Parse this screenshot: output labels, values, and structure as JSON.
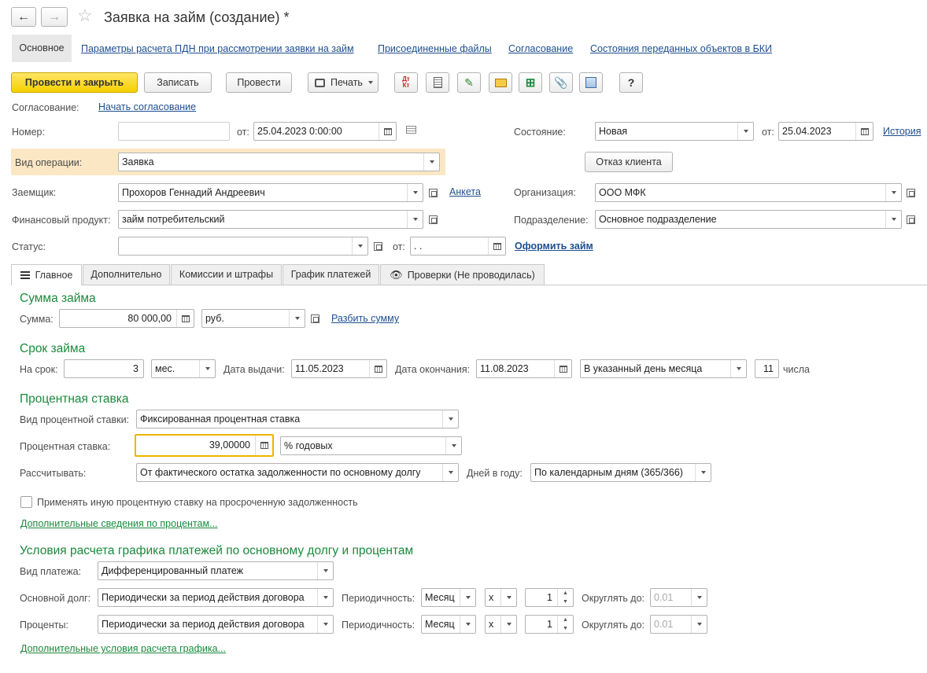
{
  "title": "Заявка на займ (создание) *",
  "nav": {
    "items": [
      "Основное",
      "Параметры расчета ПДН при рассмотрении заявки на займ",
      "Присоединенные файлы",
      "Согласование",
      "Состояния переданных объектов в БКИ"
    ]
  },
  "toolbar": {
    "post_close": "Провести и закрыть",
    "write": "Записать",
    "post": "Провести",
    "print": "Печать",
    "dtkt": "Дт Кт",
    "help": "?"
  },
  "header": {
    "approval_label": "Согласование:",
    "approval_link": "Начать согласование",
    "number_label": "Номер:",
    "number_value": "",
    "from_label": "от:",
    "date_value": "25.04.2023  0:00:00",
    "state_label": "Состояние:",
    "state_value": "Новая",
    "state_from_label": "от:",
    "state_date": "25.04.2023",
    "history_link": "История",
    "op_label": "Вид операции:",
    "op_value": "Заявка",
    "refusal_button": "Отказ клиента",
    "borrower_label": "Заемщик:",
    "borrower_value": "Прохоров Геннадий Андреевич",
    "profile_link": "Анкета",
    "org_label": "Организация:",
    "org_value": "ООО МФК",
    "product_label": "Финансовый продукт:",
    "product_value": "займ потребительский",
    "division_label": "Подразделение:",
    "division_value": "Основное подразделение",
    "status_label": "Статус:",
    "status_value": "",
    "status_from_label": "от:",
    "status_date": " .  .",
    "issue_link": "Оформить займ"
  },
  "tabs": [
    "Главное",
    "Дополнительно",
    "Комиссии и штрафы",
    "График платежей",
    "Проверки (Не проводилась)"
  ],
  "loan_sum": {
    "heading": "Сумма займа",
    "sum_label": "Сумма:",
    "sum_value": "80 000,00",
    "currency": "руб.",
    "split_link": "Разбить сумму"
  },
  "loan_term": {
    "heading": "Срок займа",
    "term_label": "На срок:",
    "term_value": "3",
    "unit": "мес.",
    "issue_label": "Дата выдачи:",
    "issue_date": "11.05.2023",
    "end_label": "Дата окончания:",
    "end_date": "11.08.2023",
    "day_mode": "В указанный день месяца",
    "day_value": "11",
    "day_suffix": "числа"
  },
  "rate": {
    "heading": "Процентная ставка",
    "type_label": "Вид процентной ставки:",
    "type_value": "Фиксированная процентная ставка",
    "rate_label": "Процентная ставка:",
    "rate_value": "39,00000",
    "rate_unit": "% годовых",
    "calc_label": "Рассчитывать:",
    "calc_value": "От фактического остатка задолженности по основному долгу",
    "days_label": "Дней в году:",
    "days_value": "По календарным дням (365/366)",
    "other_rate_checkbox": "Применять иную процентную ставку на просроченную задолженность",
    "other_rate_checked": false,
    "more_link": "Дополнительные сведения по процентам..."
  },
  "schedule": {
    "heading": "Условия расчета графика платежей по основному долгу и процентам",
    "payment_type_label": "Вид платежа:",
    "payment_type_value": "Дифференцированный платеж",
    "principal_label": "Основной долг:",
    "principal_value": "Периодически за период действия договора",
    "periodicity_label": "Периодичность:",
    "principal_period": "Месяц",
    "principal_x": "x",
    "principal_count": "1",
    "round_label": "Округлять до:",
    "principal_round": "0.01",
    "interest_label": "Проценты:",
    "interest_value": "Периодически за период действия договора",
    "interest_period": "Месяц",
    "interest_x": "x",
    "interest_count": "1",
    "interest_round": "0.01",
    "more_link": "Дополнительные условия расчета графика..."
  }
}
